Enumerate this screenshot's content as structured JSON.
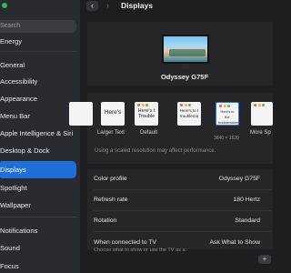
{
  "sidebar": {
    "search_placeholder": "Search",
    "items": [
      {
        "label": "Energy"
      },
      {
        "label": "General"
      },
      {
        "label": "Accessibility"
      },
      {
        "label": "Appearance"
      },
      {
        "label": "Menu Bar"
      },
      {
        "label": "Apple Intelligence & Siri"
      },
      {
        "label": "Desktop & Dock"
      },
      {
        "label": "Displays"
      },
      {
        "label": "Spotlight"
      },
      {
        "label": "Wallpaper"
      },
      {
        "label": "Notifications"
      },
      {
        "label": "Sound"
      },
      {
        "label": "Focus"
      }
    ],
    "active_item": "Displays"
  },
  "toolbar": {
    "back_icon": "chevron-left-icon",
    "forward_icon": "chevron-right-icon",
    "title": "Displays"
  },
  "display": {
    "name": "Odyssey G75F"
  },
  "resolution": {
    "options": [
      {
        "preview_text": "",
        "label": ""
      },
      {
        "preview_text": "Here's",
        "label": "Larger Text"
      },
      {
        "preview_text": "Here's t Trouble",
        "label": "Default"
      },
      {
        "preview_text": "Here's to t troublema",
        "label": ""
      },
      {
        "preview_text": "Here's to the troublemakers",
        "label": ""
      },
      {
        "preview_text": "",
        "label": "More Sp"
      }
    ],
    "selected_size": "3840 × 1620",
    "note": "Using a scaled resolution may affect performance."
  },
  "settings": {
    "color_profile": {
      "label": "Color profile",
      "value": "Odyssey G75F"
    },
    "refresh_rate": {
      "label": "Refresh rate",
      "value": "180 Hertz"
    },
    "rotation": {
      "label": "Rotation",
      "value": "Standard"
    },
    "tv": {
      "label": "When connected to TV",
      "value": "Ask What to Show",
      "sub": "Choose what to show or use the TV as a"
    }
  },
  "add_button": "+",
  "colors": {
    "accent": "#1f6fd6",
    "sidebar_bg": "#2a2b30",
    "main_bg": "#1e1e21",
    "selection_border": "#2d7ae2"
  }
}
